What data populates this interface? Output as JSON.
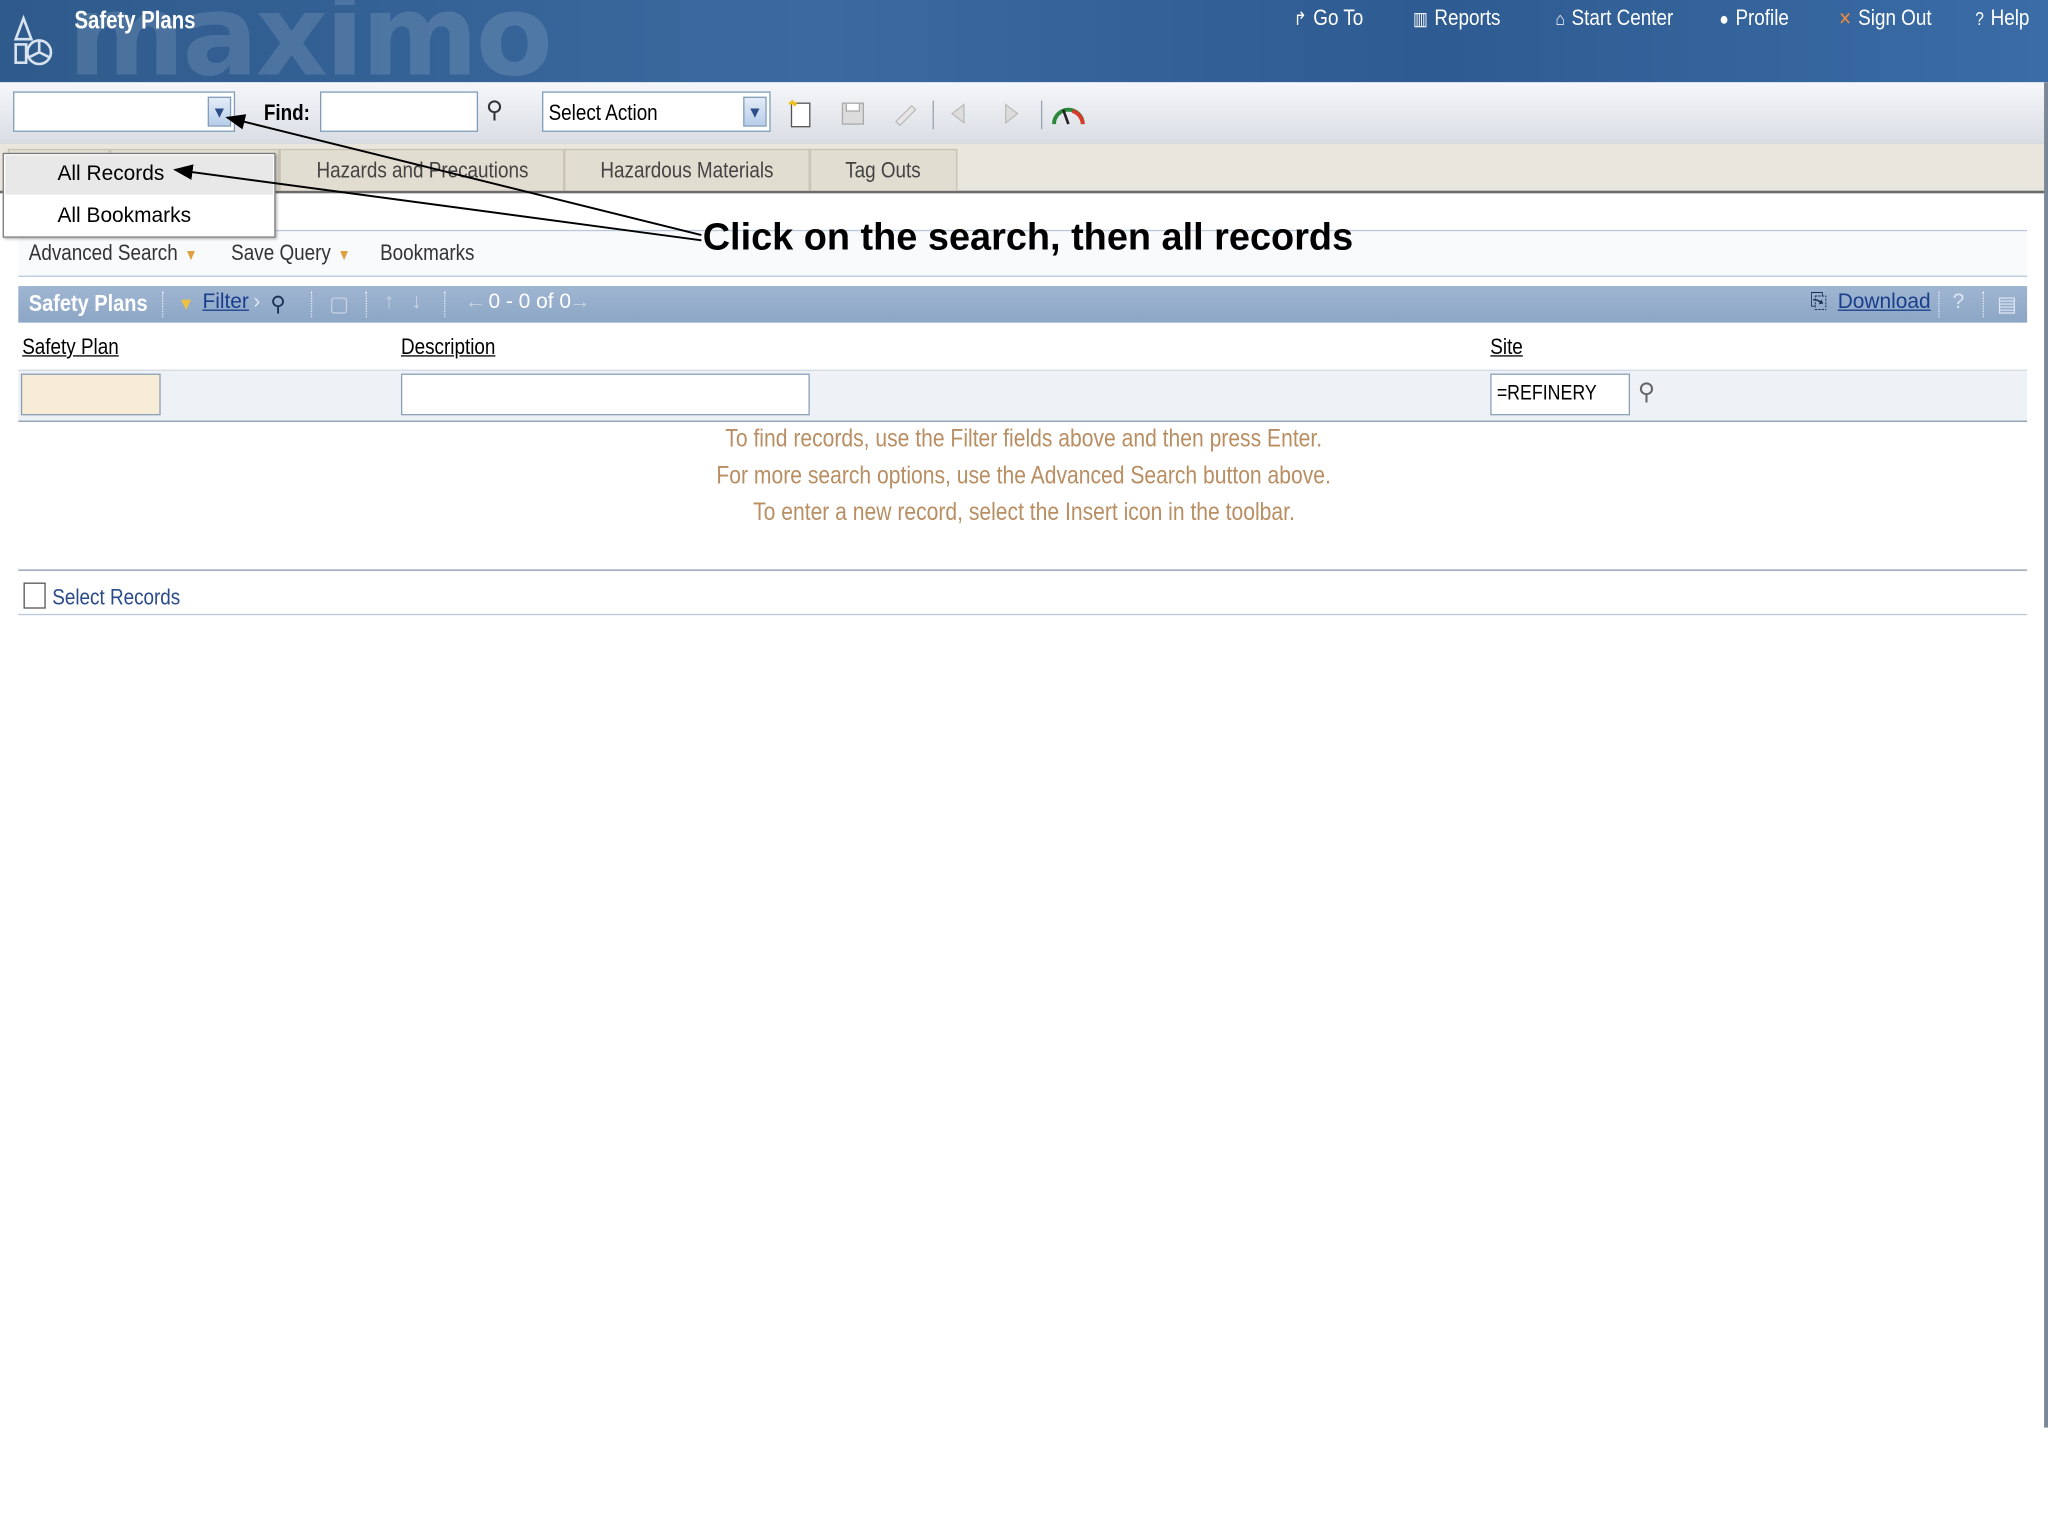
{
  "header": {
    "app_title": "Safety Plans",
    "watermark": "maximo",
    "nav": [
      {
        "label": "Go To",
        "icon": "goto-arrow-icon"
      },
      {
        "label": "Reports",
        "icon": "reports-chart-icon"
      },
      {
        "label": "Start Center",
        "icon": "home-icon"
      },
      {
        "label": "Profile",
        "icon": "person-icon"
      },
      {
        "label": "Sign Out",
        "icon": "signout-x-icon"
      },
      {
        "label": "Help",
        "icon": "help-question-icon"
      }
    ]
  },
  "toolbar": {
    "find_label": "Find:",
    "find_value": "",
    "select_action_value": "Select Action"
  },
  "tabs": [
    "Hazards and Precautions",
    "Hazardous Materials",
    "Tag Outs"
  ],
  "query_menu": {
    "items": [
      "All Records",
      "All Bookmarks"
    ],
    "selected": "All Records"
  },
  "links_bar": {
    "advanced_search": "Advanced Search",
    "save_query": "Save Query",
    "bookmarks": "Bookmarks"
  },
  "table": {
    "title": "Safety Plans",
    "filter_label": "Filter",
    "pager": "0 - 0 of 0",
    "download_label": "Download",
    "help": "?",
    "columns": [
      "Safety Plan",
      "Description",
      "Site"
    ],
    "filter_values": {
      "safety_plan": "",
      "description": "",
      "site": "=REFINERY"
    },
    "messages": [
      "To find records, use the Filter fields above and then press Enter.",
      "For more search options, use the Advanced Search button above.",
      "To enter a new record, select the Insert icon in the toolbar."
    ],
    "select_records_label": "Select Records"
  },
  "annotation": {
    "text": "Click on the search, then all records"
  },
  "colors": {
    "header_bg": "#2f5a8c",
    "table_bar": "#8ca6c6",
    "message_text": "#b88e62",
    "link_blue": "#1a3e8c"
  }
}
